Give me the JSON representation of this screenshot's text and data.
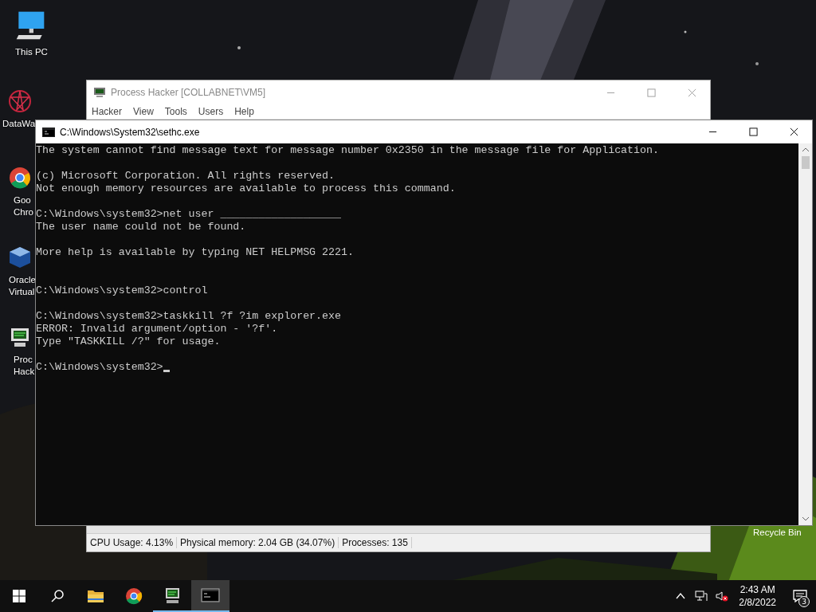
{
  "desktop": {
    "icons": [
      {
        "kind": "computer",
        "label_lines": [
          "This PC"
        ]
      },
      {
        "kind": "mandala",
        "label_lines": [
          "DataWa"
        ]
      },
      {
        "kind": "chrome",
        "label_lines": [
          "Goo",
          "Chro"
        ]
      },
      {
        "kind": "cube",
        "label_lines": [
          "Oracle",
          "Virtual"
        ]
      },
      {
        "kind": "monitor",
        "label_lines": [
          "Proc",
          "Hack"
        ]
      }
    ],
    "recycle_bin": {
      "label": "Recycle Bin"
    }
  },
  "process_hacker": {
    "title": "Process Hacker [COLLABNET\\VM5]",
    "menu": [
      "Hacker",
      "View",
      "Tools",
      "Users",
      "Help"
    ],
    "status_bar": [
      "CPU Usage: 4.13%",
      "Physical memory: 2.04 GB (34.07%)",
      "Processes: 135"
    ]
  },
  "console": {
    "title": "C:\\Windows\\System32\\sethc.exe",
    "blocks": [
      {
        "kind": "normal",
        "lines": [
          "The system cannot find message text for message number 0x2350 in the message file for Application."
        ]
      },
      {
        "kind": "normal",
        "lines": [
          "(c) Microsoft Corporation. All rights reserved.",
          "Not enough memory resources are available to process this command."
        ]
      },
      {
        "kind": "normal",
        "lines": [
          "C:\\Windows\\system32>net user ___________________",
          "The user name could not be found."
        ]
      },
      {
        "kind": "normal",
        "lines": [
          "More help is available by typing NET HELPMSG 2221."
        ]
      },
      {
        "kind": "wide",
        "lines": [
          "C:\\Windows\\system32>control"
        ]
      },
      {
        "kind": "normal",
        "lines": [
          "C:\\Windows\\system32>taskkill ?f ?im explorer.exe",
          "ERROR: Invalid argument/option - '?f'.",
          "Type \"TASKKILL /?\" for usage."
        ]
      },
      {
        "kind": "normal",
        "lines": [
          "C:\\Windows\\system32>"
        ],
        "cursor": true
      }
    ]
  },
  "taskbar": {
    "apps": [
      {
        "kind": "folder",
        "running": false,
        "active": false
      },
      {
        "kind": "chrome",
        "running": false,
        "active": false
      },
      {
        "kind": "monitor",
        "running": true,
        "active": false
      },
      {
        "kind": "console",
        "running": true,
        "active": true
      }
    ],
    "volume_muted": true,
    "clock": {
      "time": "2:43 AM",
      "date": "2/8/2022"
    },
    "notifications": {
      "count": "3"
    }
  }
}
